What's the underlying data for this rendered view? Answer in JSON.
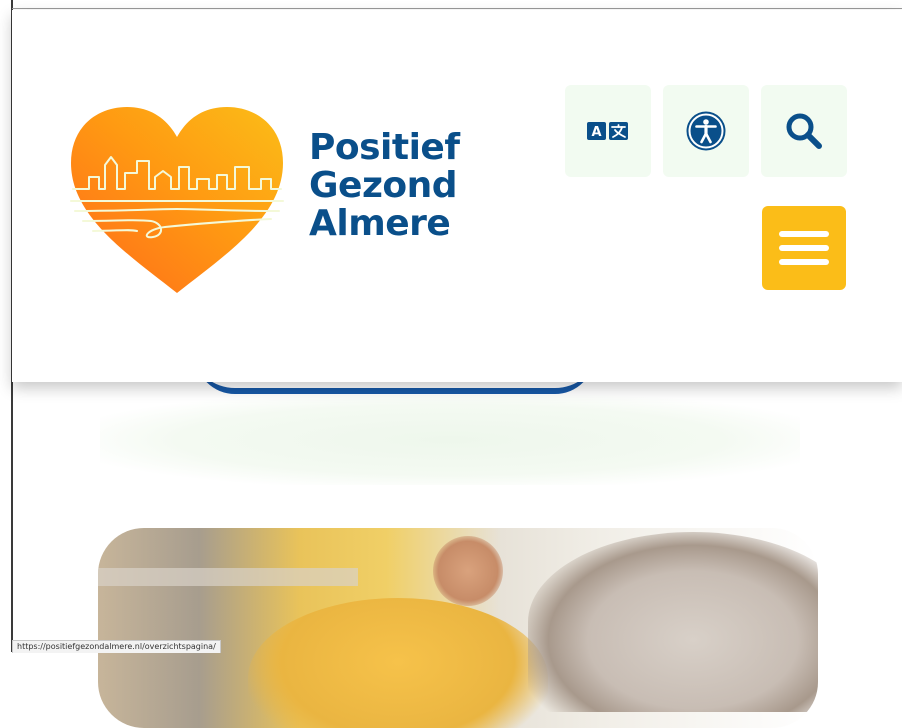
{
  "header": {
    "logo": {
      "line1": "Positief",
      "line2": "Gezond",
      "line3": "Almere",
      "text_color": "#0a4f8a",
      "heart_gradient": [
        "#ff6a1a",
        "#fbbd18"
      ]
    },
    "actions": {
      "translate_icon": "translate-icon",
      "accessibility_icon": "accessibility-icon",
      "search_icon": "search-icon",
      "menu_icon": "hamburger-menu-icon",
      "icon_color": "#0a4f8a",
      "icon_button_bg": "#f2fbf1",
      "menu_button_bg": "#fbbd18"
    }
  },
  "status_bar": {
    "url": "https://positiefgezondalmere.nl/overzichtspagina/"
  }
}
